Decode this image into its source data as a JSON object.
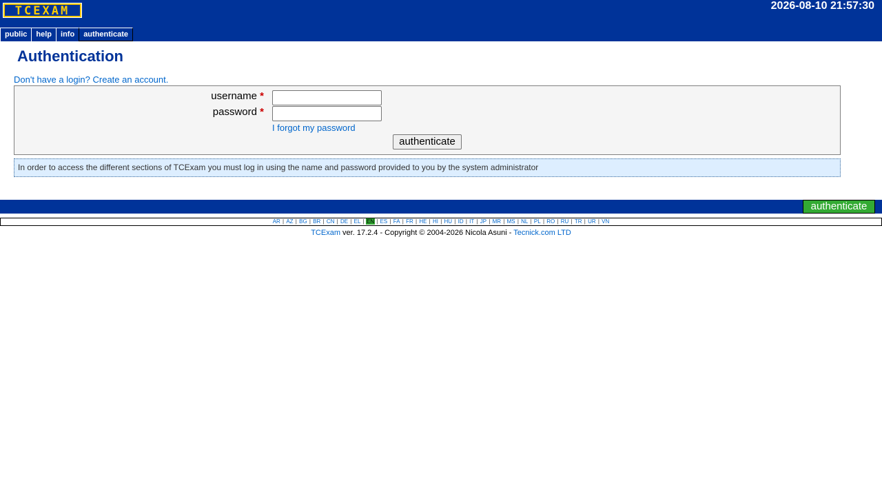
{
  "header": {
    "logo_text": "TCEXAM",
    "clock": "2026-08-10 21:57:30"
  },
  "menu": {
    "items": [
      {
        "label": "public"
      },
      {
        "label": "help"
      },
      {
        "label": "info"
      },
      {
        "label": "authenticate"
      }
    ]
  },
  "main": {
    "title": "Authentication",
    "create_account": "Don't have a login? Create an account.",
    "form": {
      "username_label": "username",
      "password_label": "password",
      "required_mark": "*",
      "username_value": "",
      "password_value": "",
      "forgot_link": "I forgot my password",
      "submit_label": "authenticate"
    },
    "info_text": "In order to access the different sections of TCExam you must log in using the name and password provided to you by the system administrator"
  },
  "footer": {
    "authenticate_label": "authenticate",
    "languages": [
      "AR",
      "AZ",
      "BG",
      "BR",
      "CN",
      "DE",
      "EL",
      "EN",
      "ES",
      "FA",
      "FR",
      "HE",
      "HI",
      "HU",
      "ID",
      "IT",
      "JP",
      "MR",
      "MS",
      "NL",
      "PL",
      "RO",
      "RU",
      "TR",
      "UR",
      "VN"
    ],
    "active_language": "EN",
    "copyright": {
      "product_link": "TCExam",
      "text": " ver. 17.2.4 - Copyright © 2004-2026 Nicola Asuni - ",
      "company_link": "Tecnick.com LTD"
    }
  },
  "colors": {
    "brand_blue": "#003399",
    "logo_yellow": "#ffcc00",
    "link_blue": "#0066cc",
    "button_green": "#33aa33",
    "info_bg": "#ddeeff"
  }
}
